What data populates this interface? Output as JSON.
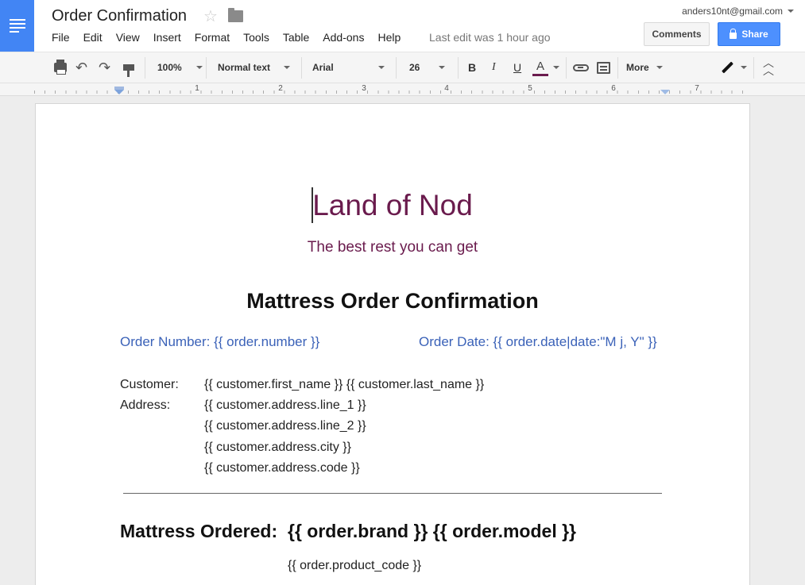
{
  "app": {
    "doc_title": "Order Confirmation",
    "menu": [
      "File",
      "Edit",
      "View",
      "Insert",
      "Format",
      "Tools",
      "Table",
      "Add-ons",
      "Help"
    ],
    "last_edit": "Last edit was 1 hour ago",
    "account_email": "anders10nt@gmail.com",
    "comments_label": "Comments",
    "share_label": "Share"
  },
  "toolbar": {
    "zoom": "100%",
    "style": "Normal text",
    "font": "Arial",
    "font_size": "26",
    "bold": "B",
    "italic": "I",
    "underline": "U",
    "text_color": "A",
    "more": "More",
    "undo_glyph": "↶",
    "redo_glyph": "↷",
    "text_color_hex": "#6a1b4d"
  },
  "ruler": {
    "numbers": [
      "1",
      "2",
      "3",
      "4",
      "5",
      "6",
      "7"
    ]
  },
  "document": {
    "title": "Land of Nod",
    "subtitle": "The best rest you can get",
    "heading": "Mattress Order Confirmation",
    "order_number": "Order Number: {{ order.number }}",
    "order_date": "Order Date: {{ order.date|date:\"M j, Y\" }}",
    "customer_label": "Customer:",
    "customer_value": "{{ customer.first_name }} {{ customer.last_name }}",
    "address_label": "Address:",
    "address_lines": [
      "{{ customer.address.line_1 }}",
      "{{ customer.address.line_2 }}",
      "{{ customer.address.city }}",
      "{{ customer.address.code }}"
    ],
    "mattress_label": "Mattress Ordered:",
    "mattress_value": "{{ order.brand }} {{ order.model }}",
    "product_code": "{{ order.product_code }}"
  },
  "colors": {
    "brand_blue": "#4285f4",
    "share_blue": "#4d90fe",
    "title_plum": "#6a1b4d",
    "link_blue": "#3b62b8"
  }
}
